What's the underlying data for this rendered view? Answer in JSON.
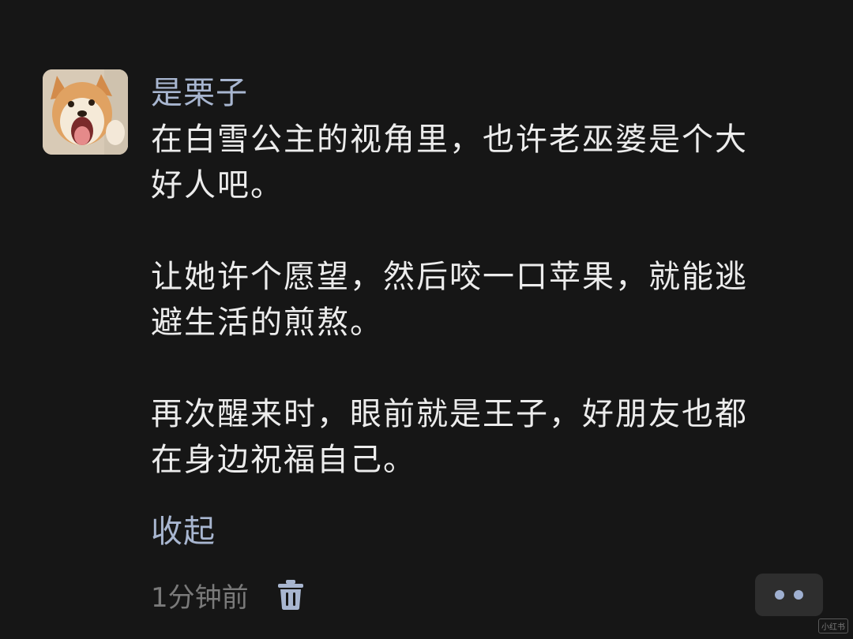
{
  "comment": {
    "username": "是栗子",
    "paragraphs": [
      [
        "在白雪公主的视角里，也许老巫婆是个大",
        "好人吧。"
      ],
      [
        "让她许个愿望，然后咬一口苹果，就能逃",
        "避生活的煎熬。"
      ],
      [
        "再次醒来时，眼前就是王子，好朋友也都",
        "在身边祝福自己。"
      ]
    ],
    "collapse_label": "收起",
    "timestamp": "1分钟前",
    "delete_icon": "trash-icon",
    "more_icon": "more-dots-icon"
  },
  "watermark": "小红书",
  "colors": {
    "background": "#161616",
    "username": "#a8b6d0",
    "link": "#a8b6d0",
    "text": "#ececec",
    "meta": "#7a7a7a"
  }
}
